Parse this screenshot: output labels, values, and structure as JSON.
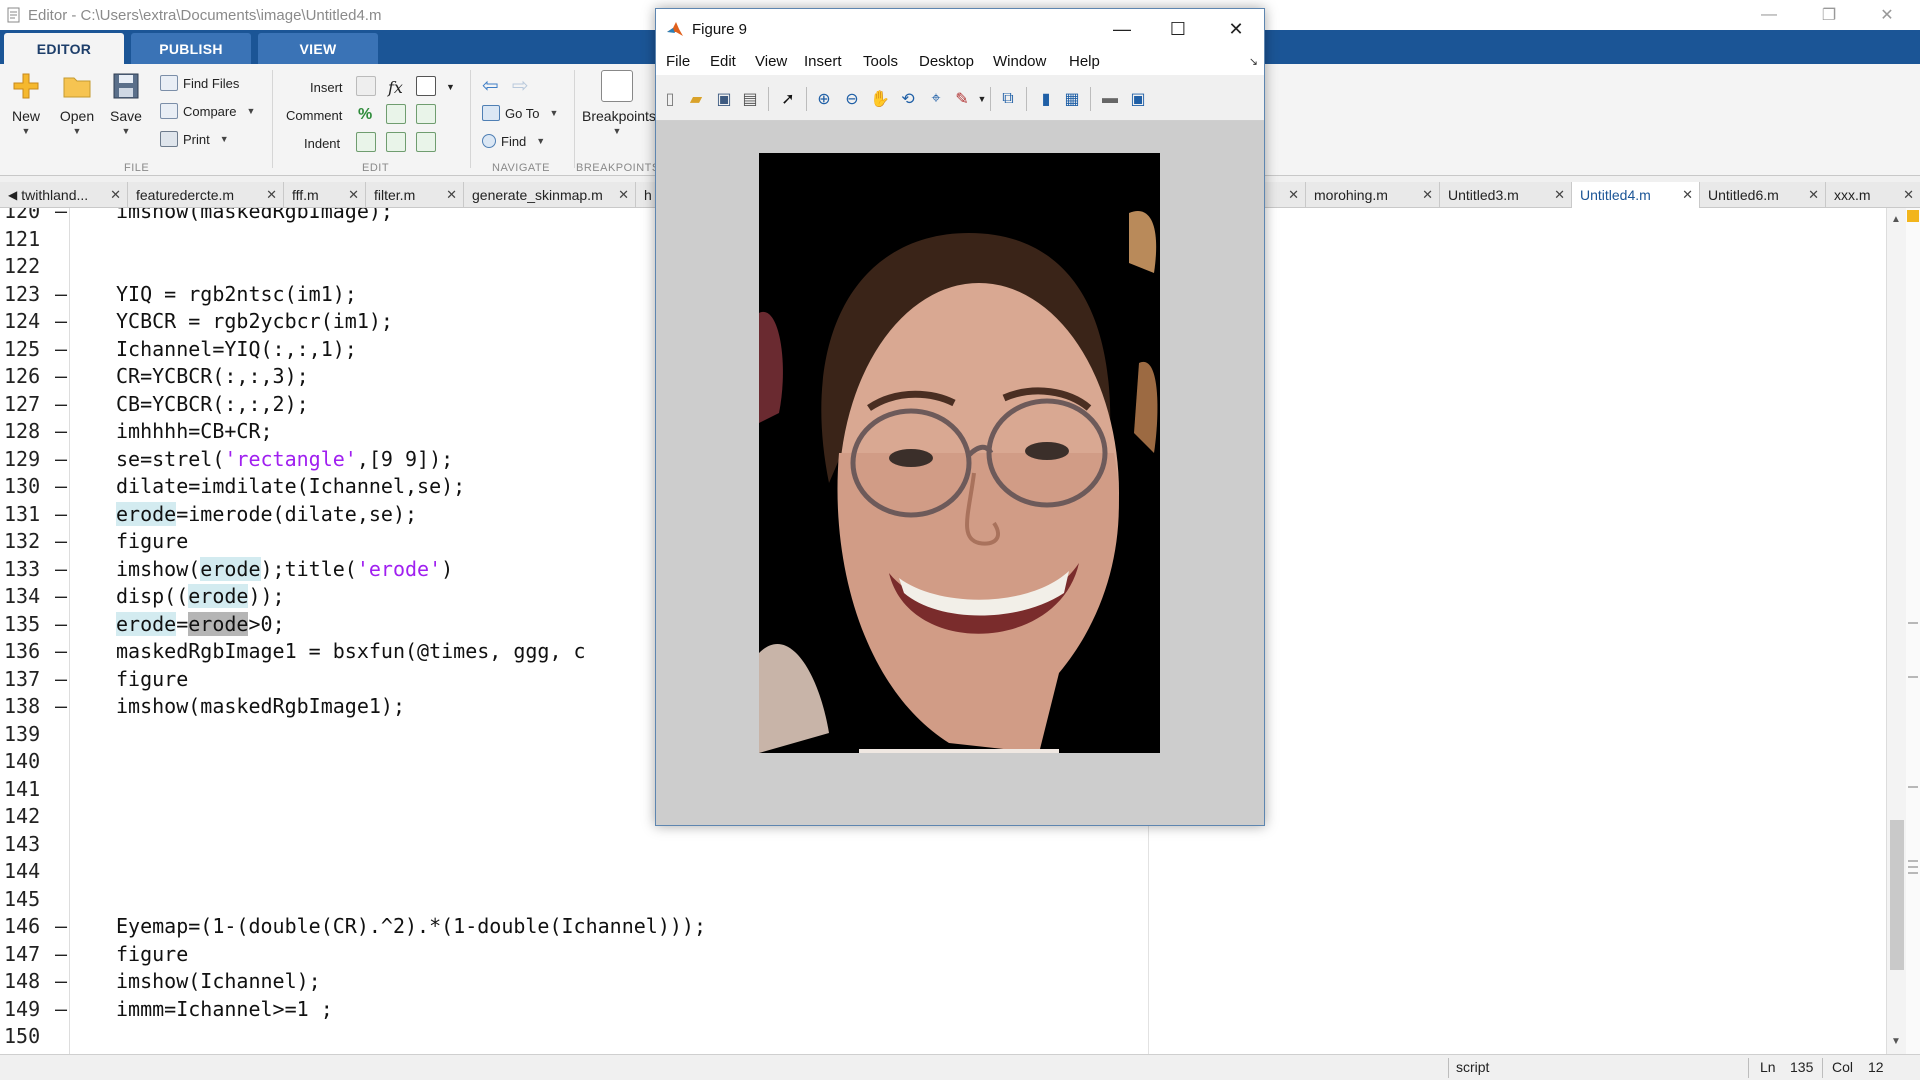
{
  "window": {
    "title": "Editor - C:\\Users\\extra\\Documents\\image\\Untitled4.m"
  },
  "ribbon_tabs": [
    "EDITOR",
    "PUBLISH",
    "VIEW"
  ],
  "ribbon": {
    "file": {
      "new": "New",
      "open": "Open",
      "save": "Save",
      "find_files": "Find Files",
      "compare": "Compare",
      "print": "Print",
      "group": "FILE"
    },
    "edit": {
      "insert": "Insert",
      "comment": "Comment",
      "indent": "Indent",
      "fx": "fx",
      "group": "EDIT"
    },
    "navigate": {
      "goto": "Go To",
      "find": "Find",
      "group": "NAVIGATE"
    },
    "breakpoints": {
      "label": "Breakpoints",
      "group": "BREAKPOINTS"
    }
  },
  "doc_tabs": [
    {
      "label": "twithland...",
      "active": false
    },
    {
      "label": "featuredercte.m",
      "active": false
    },
    {
      "label": "fff.m",
      "active": false
    },
    {
      "label": "filter.m",
      "active": false
    },
    {
      "label": "generate_skinmap.m",
      "active": false
    },
    {
      "label": "h",
      "active": false
    },
    {
      "label": "morohing.m",
      "active": false
    },
    {
      "label": "Untitled3.m",
      "active": false
    },
    {
      "label": "Untitled4.m",
      "active": true
    },
    {
      "label": "Untitled6.m",
      "active": false
    },
    {
      "label": "xxx.m",
      "active": false
    }
  ],
  "code": [
    {
      "ln": "120",
      "dash": "–",
      "text": "imshow(maskedRgbImage);"
    },
    {
      "ln": "121",
      "dash": "",
      "text": ""
    },
    {
      "ln": "122",
      "dash": "",
      "text": ""
    },
    {
      "ln": "123",
      "dash": "–",
      "text": "YIQ = rgb2ntsc(im1);"
    },
    {
      "ln": "124",
      "dash": "–",
      "text": "YCBCR = rgb2ycbcr(im1);"
    },
    {
      "ln": "125",
      "dash": "–",
      "text": "Ichannel=YIQ(:,:,1);"
    },
    {
      "ln": "126",
      "dash": "–",
      "text": "CR=YCBCR(:,:,3);"
    },
    {
      "ln": "127",
      "dash": "–",
      "text": "CB=YCBCR(:,:,2);"
    },
    {
      "ln": "128",
      "dash": "–",
      "text": "imhhhh=CB+CR;"
    },
    {
      "ln": "129",
      "dash": "–",
      "pre": "se=strel(",
      "str": "'rectangle'",
      "post": ",[9 9]);"
    },
    {
      "ln": "130",
      "dash": "–",
      "text": "dilate=imdilate(Ichannel,se);"
    },
    {
      "ln": "131",
      "dash": "–",
      "h1": "erode",
      "rest": "=imerode(dilate,se);"
    },
    {
      "ln": "132",
      "dash": "–",
      "text": "figure"
    },
    {
      "ln": "133",
      "dash": "–",
      "a": "imshow(",
      "h1": "erode",
      "b": ");title(",
      "str": "'erode'",
      "c": ")"
    },
    {
      "ln": "134",
      "dash": "–",
      "a": "disp((",
      "h1": "erode",
      "b": "));"
    },
    {
      "ln": "135",
      "dash": "–",
      "h1": "erode",
      "a": "=",
      "h2": "erode",
      "b": ">0;"
    },
    {
      "ln": "136",
      "dash": "–",
      "text": "maskedRgbImage1 = bsxfun(@times, ggg, c"
    },
    {
      "ln": "137",
      "dash": "–",
      "text": "figure"
    },
    {
      "ln": "138",
      "dash": "–",
      "text": "imshow(maskedRgbImage1);"
    },
    {
      "ln": "139",
      "dash": "",
      "text": ""
    },
    {
      "ln": "140",
      "dash": "",
      "text": ""
    },
    {
      "ln": "141",
      "dash": "",
      "text": ""
    },
    {
      "ln": "142",
      "dash": "",
      "text": ""
    },
    {
      "ln": "143",
      "dash": "",
      "text": ""
    },
    {
      "ln": "144",
      "dash": "",
      "text": ""
    },
    {
      "ln": "145",
      "dash": "",
      "text": ""
    },
    {
      "ln": "146",
      "dash": "–",
      "text": "Eyemap=(1-(double(CR).^2).*(1-double(Ichannel)));"
    },
    {
      "ln": "147",
      "dash": "–",
      "text": "figure"
    },
    {
      "ln": "148",
      "dash": "–",
      "text": "imshow(Ichannel);"
    },
    {
      "ln": "149",
      "dash": "–",
      "text": "immm=Ichannel>=1 ;"
    },
    {
      "ln": "150",
      "dash": "",
      "text": ""
    }
  ],
  "status": {
    "mode": "script",
    "ln_label": "Ln",
    "ln": "135",
    "col_label": "Col",
    "col": "12"
  },
  "figure": {
    "title": "Figure 9",
    "menu": [
      "File",
      "Edit",
      "View",
      "Insert",
      "Tools",
      "Desktop",
      "Window",
      "Help"
    ]
  },
  "colors": {
    "ribbon_blue": "#1b5596",
    "string": "#a020f0",
    "highlight": "#d3ebf0"
  }
}
